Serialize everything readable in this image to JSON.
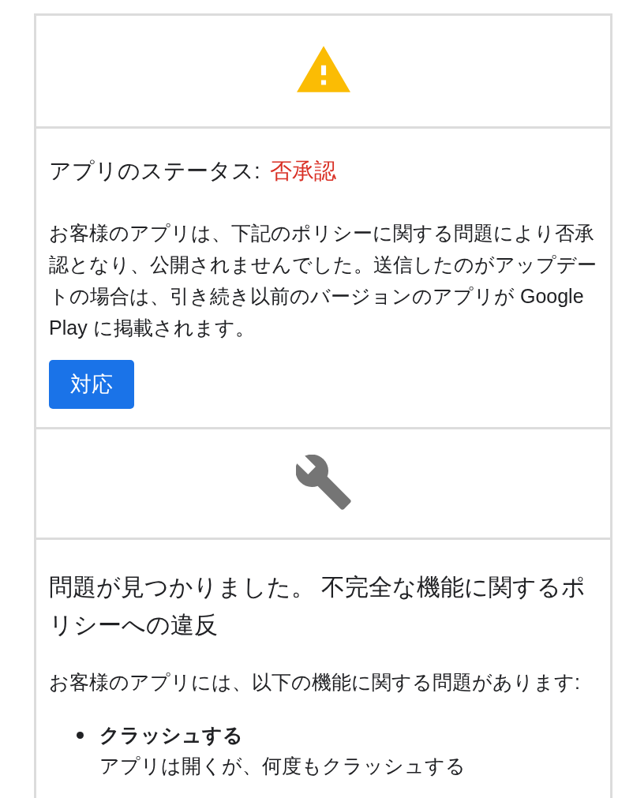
{
  "status_card": {
    "label": "アプリのステータス:",
    "status": "否承認",
    "description": "お客様のアプリは、下記のポリシーに関する問題により否承認となり、公開されませんでした。送信したのがアップデートの場合は、引き続き以前のバージョンのアプリが Google Play に掲載されます。",
    "button": "対応"
  },
  "issue_card": {
    "title": "問題が見つかりました。 不完全な機能に関するポリシーへの違反",
    "intro": "お客様のアプリには、以下の機能に関する問題があります:",
    "issues": [
      {
        "name": "クラッシュする",
        "detail": "アプリは開くが、何度もクラッシュする"
      }
    ]
  }
}
